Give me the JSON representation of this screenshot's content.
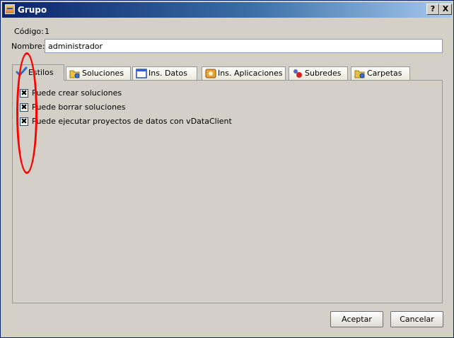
{
  "window": {
    "title": "Grupo",
    "help_button": "?",
    "close_button": "X"
  },
  "form": {
    "code_label": "Código:",
    "code_value": "1",
    "name_label": "Nombre:",
    "name_value": "administrador"
  },
  "tabs": [
    {
      "label": "Estilos",
      "icon": "checkmark-icon",
      "active": true
    },
    {
      "label": "Soluciones",
      "icon": "solutions-icon",
      "active": false
    },
    {
      "label": "Ins. Datos",
      "icon": "data-window-icon",
      "active": false
    },
    {
      "label": "Ins. Aplicaciones",
      "icon": "applications-icon",
      "active": false
    },
    {
      "label": "Subredes",
      "icon": "network-icon",
      "active": false
    },
    {
      "label": "Carpetas",
      "icon": "folders-icon",
      "active": false
    }
  ],
  "permissions": [
    {
      "label": "Puede crear soluciones",
      "checked": true
    },
    {
      "label": "Puede borrar soluciones",
      "checked": true
    },
    {
      "label": "Puede ejecutar proyectos de datos con vDataClient",
      "checked": true
    }
  ],
  "buttons": {
    "accept": "Aceptar",
    "cancel": "Cancelar"
  },
  "annotation_color": "#ff0000",
  "titlebar_color": "#0a246a"
}
